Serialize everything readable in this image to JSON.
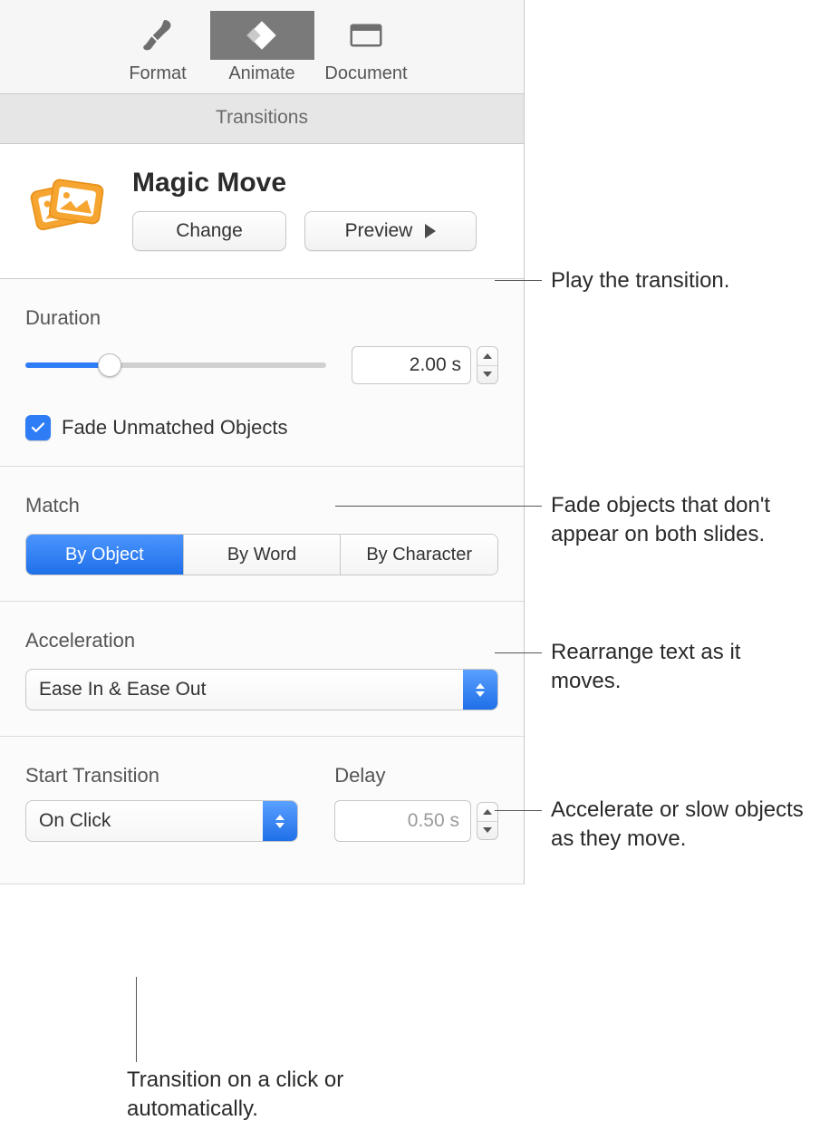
{
  "toolbar": {
    "format_label": "Format",
    "animate_label": "Animate",
    "document_label": "Document",
    "active": "animate"
  },
  "pane": {
    "title": "Transitions"
  },
  "effect": {
    "name": "Magic Move",
    "change_label": "Change",
    "preview_label": "Preview"
  },
  "duration": {
    "title": "Duration",
    "value": "2.00 s",
    "slider_percent": 28
  },
  "fade_unmatched": {
    "label": "Fade Unmatched Objects",
    "checked": true
  },
  "match": {
    "title": "Match",
    "options": [
      "By Object",
      "By Word",
      "By Character"
    ],
    "selected_index": 0
  },
  "acceleration": {
    "title": "Acceleration",
    "value": "Ease In & Ease Out"
  },
  "start": {
    "title": "Start Transition",
    "value": "On Click"
  },
  "delay": {
    "title": "Delay",
    "value": "0.50 s"
  },
  "annotations": {
    "preview": "Play the transition.",
    "fade": "Fade objects that don't appear on both slides.",
    "match": "Rearrange text as it moves.",
    "accel": "Accelerate or slow objects as they move.",
    "start": "Transition on a click or automatically."
  }
}
